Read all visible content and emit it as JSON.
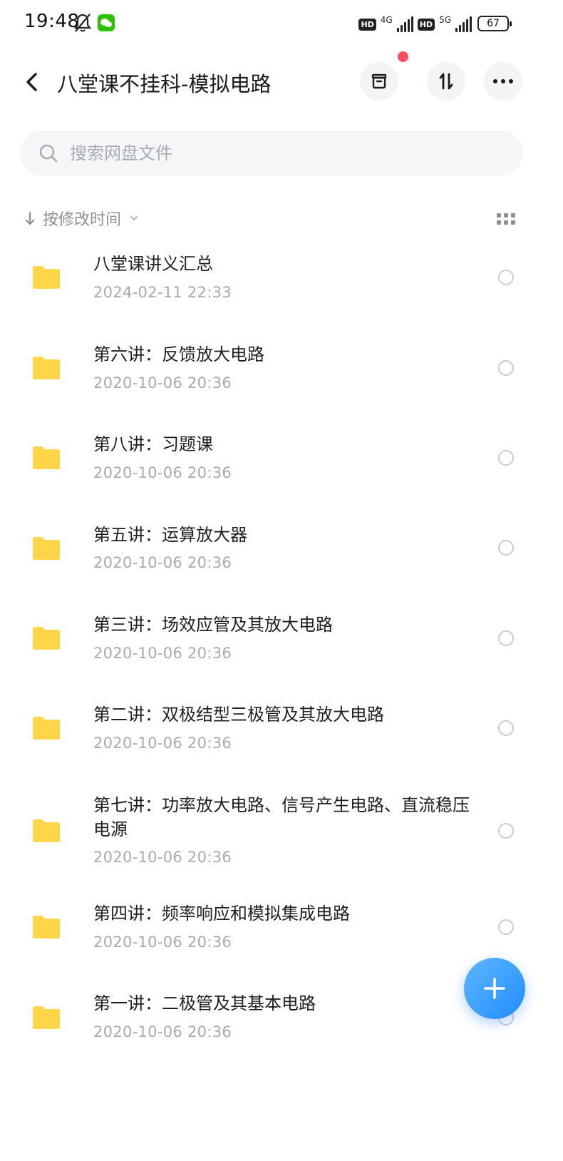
{
  "status_bar": {
    "time": "19:48",
    "hd1": "HD",
    "net1": "4G",
    "hd2": "HD",
    "net2": "5G",
    "battery": "67"
  },
  "header": {
    "back_icon": "chevron-left-icon",
    "title": "八堂课不挂科-模拟电路",
    "buttons": [
      "archive-icon",
      "sort-arrows-icon",
      "more-icon"
    ],
    "notification_dot_color": "#ff4d5f"
  },
  "search": {
    "placeholder": "搜索网盘文件",
    "value": ""
  },
  "sort": {
    "label": "按修改时间"
  },
  "files": [
    {
      "name": "八堂课讲义汇总",
      "time": "2024-02-11  22:33"
    },
    {
      "name": "第六讲：反馈放大电路",
      "time": "2020-10-06  20:36"
    },
    {
      "name": "第八讲：习题课",
      "time": "2020-10-06  20:36"
    },
    {
      "name": "第五讲：运算放大器",
      "time": "2020-10-06  20:36"
    },
    {
      "name": "第三讲：场效应管及其放大电路",
      "time": "2020-10-06  20:36"
    },
    {
      "name": "第二讲：双极结型三极管及其放大电路",
      "time": "2020-10-06  20:36"
    },
    {
      "name": "第七讲：功率放大电路、信号产生电路、直流稳压电源",
      "time": "2020-10-06  20:36"
    },
    {
      "name": "第四讲：频率响应和模拟集成电路",
      "time": "2020-10-06  20:36"
    },
    {
      "name": "第一讲：二极管及其基本电路",
      "time": "2020-10-06  20:36"
    }
  ],
  "colors": {
    "folder": "#ffd54a",
    "accent": "#1f8cff",
    "secondary_text": "#a5a9b1"
  }
}
